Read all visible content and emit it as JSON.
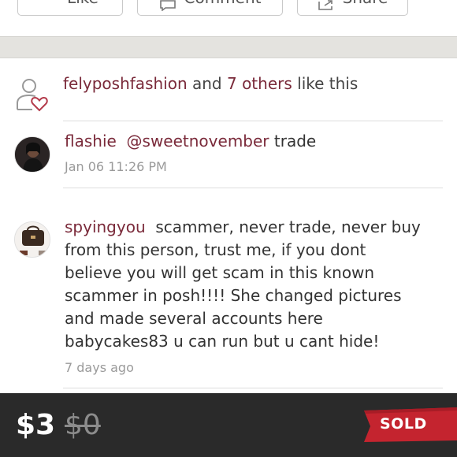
{
  "actions": {
    "like_label": "Like",
    "comment_label": "Comment",
    "share_label": "Share"
  },
  "likes": {
    "user": "felyposhfashion",
    "joiner": " and ",
    "others": "7 others",
    "suffix": " like this"
  },
  "comments": [
    {
      "user": "flashie",
      "mention": "@sweetnovember",
      "text": " trade",
      "time": "Jan 06 11:26 PM"
    },
    {
      "user": "spyingyou",
      "text": "  scammer, never trade, never buy from this person, trust me, if you dont believe you will get scam in this known scammer in posh!!!! She changed pictures and made several accounts here babycakes83 u can run but u cant hide!",
      "time": "7 days ago"
    }
  ],
  "footer": {
    "price": "$3",
    "original_price": "$0",
    "status": "SOLD"
  },
  "colors": {
    "link": "#7a2a3a",
    "footer_bg": "#2a2a2a",
    "sold_ribbon": "#c4242f",
    "band": "#e4e3df"
  }
}
